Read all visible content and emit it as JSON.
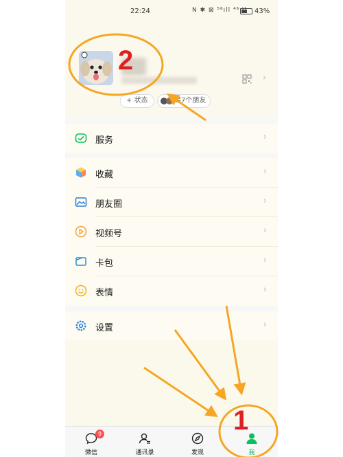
{
  "status_bar": {
    "time": "22:24",
    "icons": "N ✱ ⊠ ⁵⁶ıll ⁴⁶ıll",
    "battery": "43%"
  },
  "profile": {
    "status_button": "+ 状态",
    "friends_text": "等7个朋友"
  },
  "menu": {
    "services": "服务",
    "favorites": "收藏",
    "moments": "朋友圈",
    "channels": "视频号",
    "card_wallet": "卡包",
    "stickers": "表情",
    "settings": "设置"
  },
  "tabs": [
    {
      "label": "微信",
      "badge": "9"
    },
    {
      "label": "通讯录"
    },
    {
      "label": "发现"
    },
    {
      "label": "我"
    }
  ],
  "annotations": {
    "num1": "1",
    "num2": "2"
  },
  "colors": {
    "accent": "#07c160",
    "badge": "#fa5151",
    "annotation_orange": "#f5a623",
    "annotation_red": "#e02020"
  }
}
